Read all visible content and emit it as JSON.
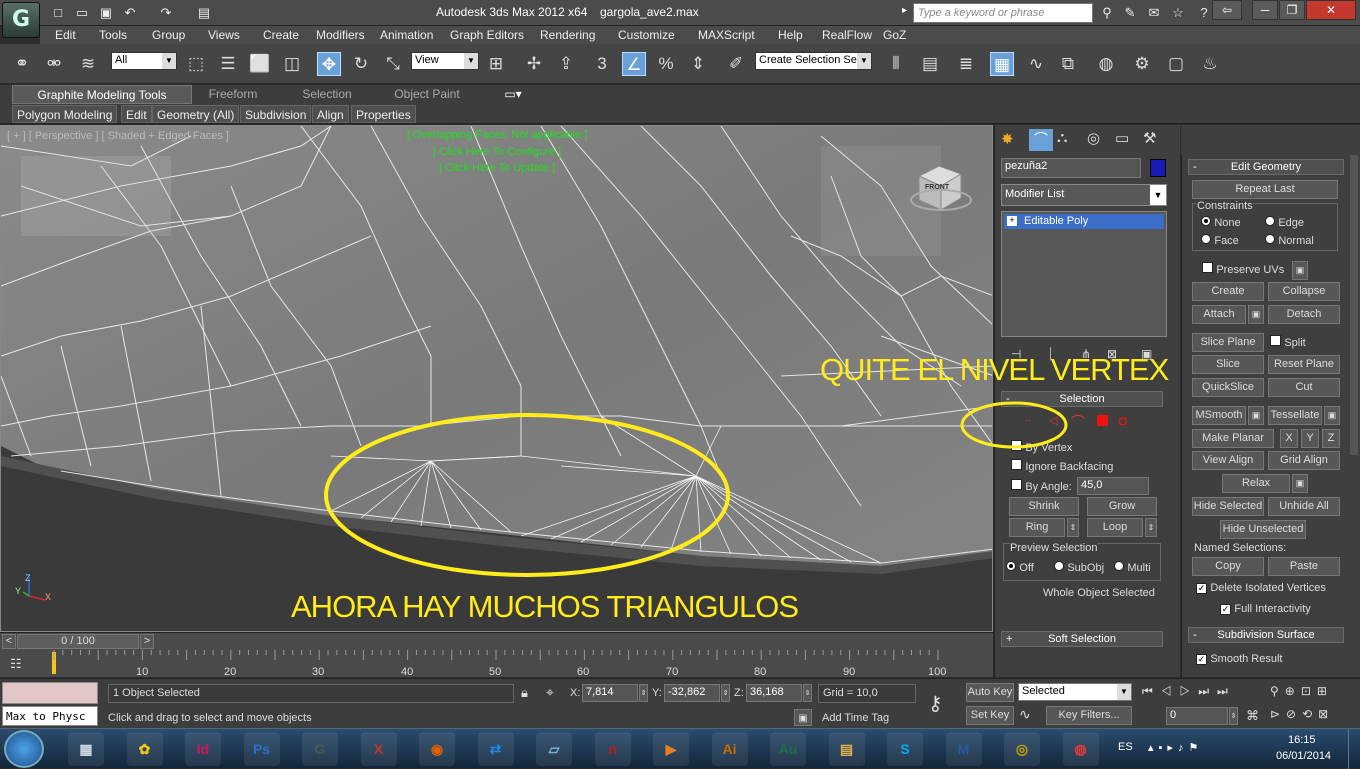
{
  "window": {
    "title": "Autodesk 3ds Max  2012 x64",
    "filename": "gargola_ave2.max",
    "search_placeholder": "Type a keyword or phrase",
    "app_logo_glyph": "G"
  },
  "menu": [
    "Edit",
    "Tools",
    "Group",
    "Views",
    "Create",
    "Modifiers",
    "Animation",
    "Graph Editors",
    "Rendering",
    "Customize",
    "MAXScript",
    "Help",
    "RealFlow",
    "GoZ"
  ],
  "toolbar": {
    "filter_select": "All",
    "ref_coord": "View",
    "named_selection": "Create Selection Se",
    "snap_label": "3",
    "percent_label": "%"
  },
  "ribbon": {
    "tabs": [
      "Graphite Modeling Tools",
      "Freeform",
      "Selection",
      "Object Paint"
    ],
    "sub_tabs": [
      "Polygon Modeling",
      "Edit",
      "Geometry (All)",
      "Subdivision",
      "Align",
      "Properties"
    ]
  },
  "viewport": {
    "label": "[ + ] [ Perspective ] [ Shaded + Edged Faces ]",
    "messages": [
      "[ Overlapping Faces: Not applicable ]",
      "[ Click Here To Configure ]",
      "[ Click Here To Update ]"
    ],
    "viewcube_label": "FRONT",
    "annotation_top": "QUITE EL NIVEL VERTEX",
    "annotation_bottom": "AHORA HAY MUCHOS TRIANGULOS",
    "annotation_color": "#ffec1a",
    "axis_labels": [
      "Z",
      "X",
      "Y"
    ]
  },
  "timeline": {
    "counter": "0 / 100",
    "prev": "<",
    "next": ">",
    "ticks": [
      "10",
      "20",
      "30",
      "40",
      "50",
      "60",
      "70",
      "80",
      "90",
      "100"
    ]
  },
  "command_panel": {
    "object_name": "pezuña2",
    "object_color": "#1a1ab4",
    "modifier_list": "Modifier List",
    "stack_item": "Editable Poly",
    "selection": {
      "header": "Selection",
      "by_vertex": "By Vertex",
      "ignore_backfacing": "Ignore Backfacing",
      "by_angle": "By Angle:",
      "angle_value": "45,0",
      "shrink": "Shrink",
      "grow": "Grow",
      "ring": "Ring",
      "loop": "Loop",
      "preview_header": "Preview Selection",
      "preview_off": "Off",
      "preview_subobj": "SubObj",
      "preview_multi": "Multi",
      "status": "Whole Object Selected"
    },
    "soft_selection": "Soft Selection"
  },
  "edit_geometry": {
    "header": "Edit Geometry",
    "repeat_last": "Repeat Last",
    "constraints": "Constraints",
    "c_none": "None",
    "c_edge": "Edge",
    "c_face": "Face",
    "c_normal": "Normal",
    "preserve_uvs": "Preserve UVs",
    "create": "Create",
    "collapse": "Collapse",
    "attach": "Attach",
    "detach": "Detach",
    "slice_plane": "Slice Plane",
    "split": "Split",
    "slice": "Slice",
    "reset_plane": "Reset Plane",
    "quickslice": "QuickSlice",
    "cut": "Cut",
    "msmooth": "MSmooth",
    "tessellate": "Tessellate",
    "make_planar": "Make Planar",
    "x": "X",
    "y": "Y",
    "z": "Z",
    "view_align": "View Align",
    "grid_align": "Grid Align",
    "relax": "Relax",
    "hide_selected": "Hide Selected",
    "unhide_all": "Unhide All",
    "hide_unselected": "Hide Unselected",
    "named_selections": "Named Selections:",
    "copy": "Copy",
    "paste": "Paste",
    "delete_isolated": "Delete Isolated Vertices",
    "full_interactivity": "Full Interactivity",
    "subdiv_header": "Subdivision Surface",
    "smooth_result": "Smooth Result"
  },
  "status": {
    "script_listener": "Max to Physc",
    "selected": "1 Object Selected",
    "prompt": "Click and drag to select and move objects",
    "x_label": "X:",
    "x": "7,814",
    "y_label": "Y:",
    "y": "-32,862",
    "z_label": "Z:",
    "z": "36,168",
    "grid": "Grid = 10,0",
    "add_time_tag": "Add Time Tag",
    "auto_key": "Auto Key",
    "set_key": "Set Key",
    "key_mode": "Selected",
    "key_filters": "Key Filters...",
    "frame": "0"
  },
  "taskbar": {
    "apps": [
      "Calculator",
      "3ds Max Bonus",
      "InDesign",
      "Photoshop",
      "3ds Max",
      "Xara 3D",
      "Firefox",
      "TeamViewer",
      "Notepad",
      "Nero",
      "Media Player",
      "Illustrator",
      "Audition",
      "Explorer",
      "Skype",
      "Malwarebytes",
      "Snagit",
      "Chrome"
    ],
    "lang": "ES",
    "time": "16:15",
    "date": "06/01/2014"
  }
}
